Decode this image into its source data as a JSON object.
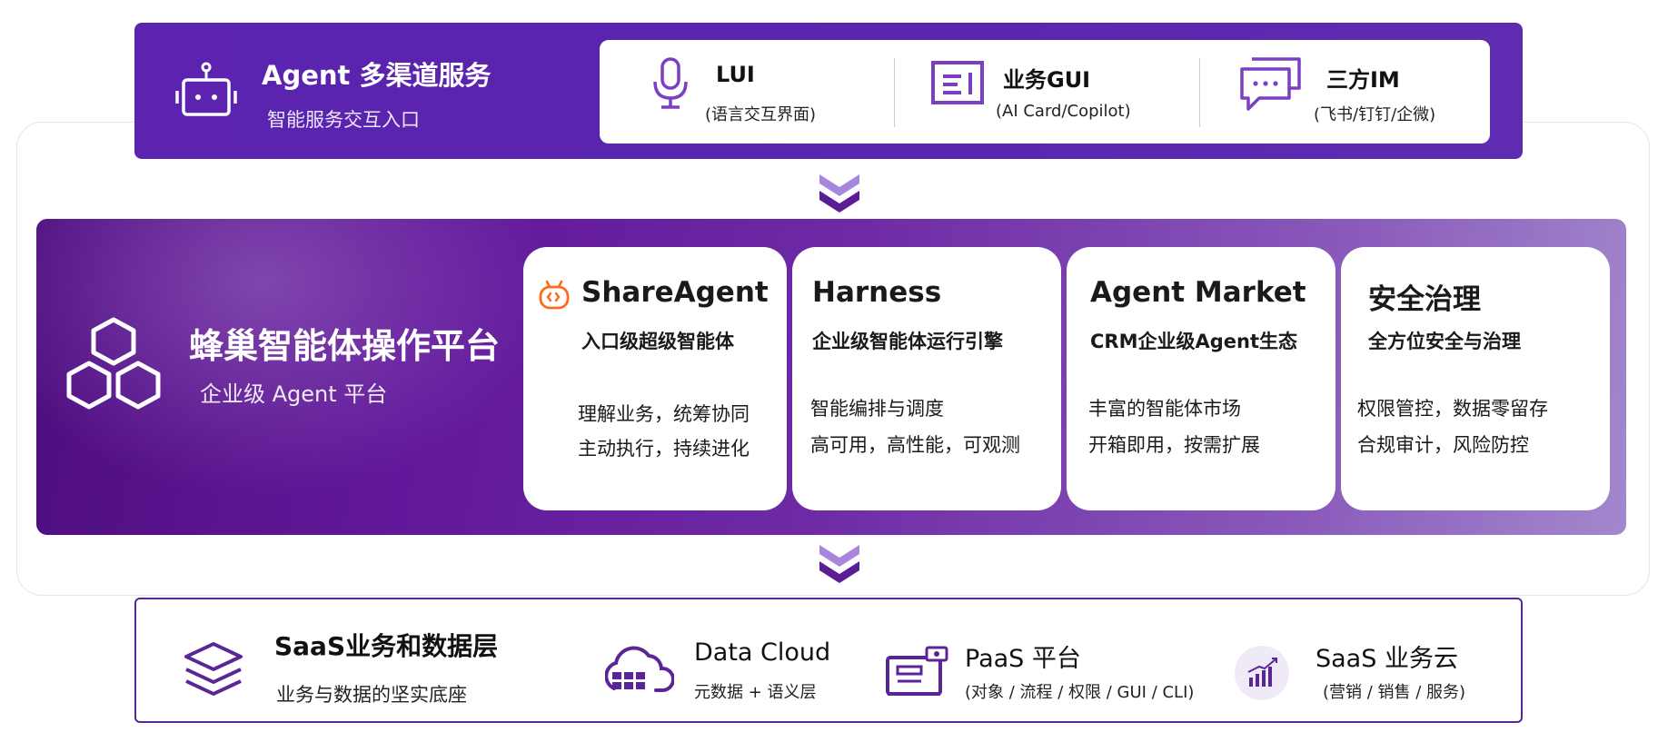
{
  "colors": {
    "primary": "#5b23b0",
    "accent_purple": "#7b3fc4",
    "icon_purple": "#5a2596",
    "bottom_border": "#5a2596",
    "agent_icon_orange": "#ff6a1a"
  },
  "top": {
    "title": "Agent 多渠道服务",
    "subtitle": "智能服务交互入口",
    "icon": "robot-icon",
    "channels": [
      {
        "name": "LUI",
        "desc": "(语言交互界面)",
        "icon": "microphone-icon"
      },
      {
        "name": "业务GUI",
        "desc": "(AI Card/Copilot)",
        "icon": "gui-card-icon"
      },
      {
        "name": "三方IM",
        "desc": "(飞书/钉钉/企微)",
        "icon": "chat-bubbles-icon"
      }
    ]
  },
  "middle": {
    "title": "蜂巢智能体操作平台",
    "subtitle": "企业级 Agent 平台",
    "icon": "honeycomb-icon",
    "cards": [
      {
        "title": "ShareAgent",
        "subtitle": "入口级超级智能体",
        "lines": [
          "理解业务，统筹协同",
          "主动执行，持续进化"
        ],
        "icon": "share-agent-icon"
      },
      {
        "title": "Harness",
        "subtitle": "企业级智能体运行引擎",
        "lines": [
          "智能编排与调度",
          "高可用，高性能，可观测"
        ]
      },
      {
        "title": "Agent Market",
        "subtitle": "CRM企业级Agent生态",
        "lines": [
          "丰富的智能体市场",
          "开箱即用，按需扩展"
        ]
      },
      {
        "title": "安全治理",
        "subtitle": "全方位安全与治理",
        "lines": [
          "权限管控，数据零留存",
          "合规审计，风险防控"
        ]
      }
    ]
  },
  "bottom": {
    "title": "SaaS业务和数据层",
    "subtitle": "业务与数据的坚实底座",
    "icon": "layers-icon",
    "services": [
      {
        "name": "Data Cloud",
        "desc": "元数据 + 语义层",
        "icon": "data-cloud-icon"
      },
      {
        "name": "PaaS 平台",
        "desc": "(对象 / 流程 / 权限 / GUI / CLI)",
        "icon": "paas-platform-icon"
      },
      {
        "name": "SaaS 业务云",
        "desc": "(营销 / 销售 / 服务)",
        "icon": "saas-chart-icon"
      }
    ]
  }
}
